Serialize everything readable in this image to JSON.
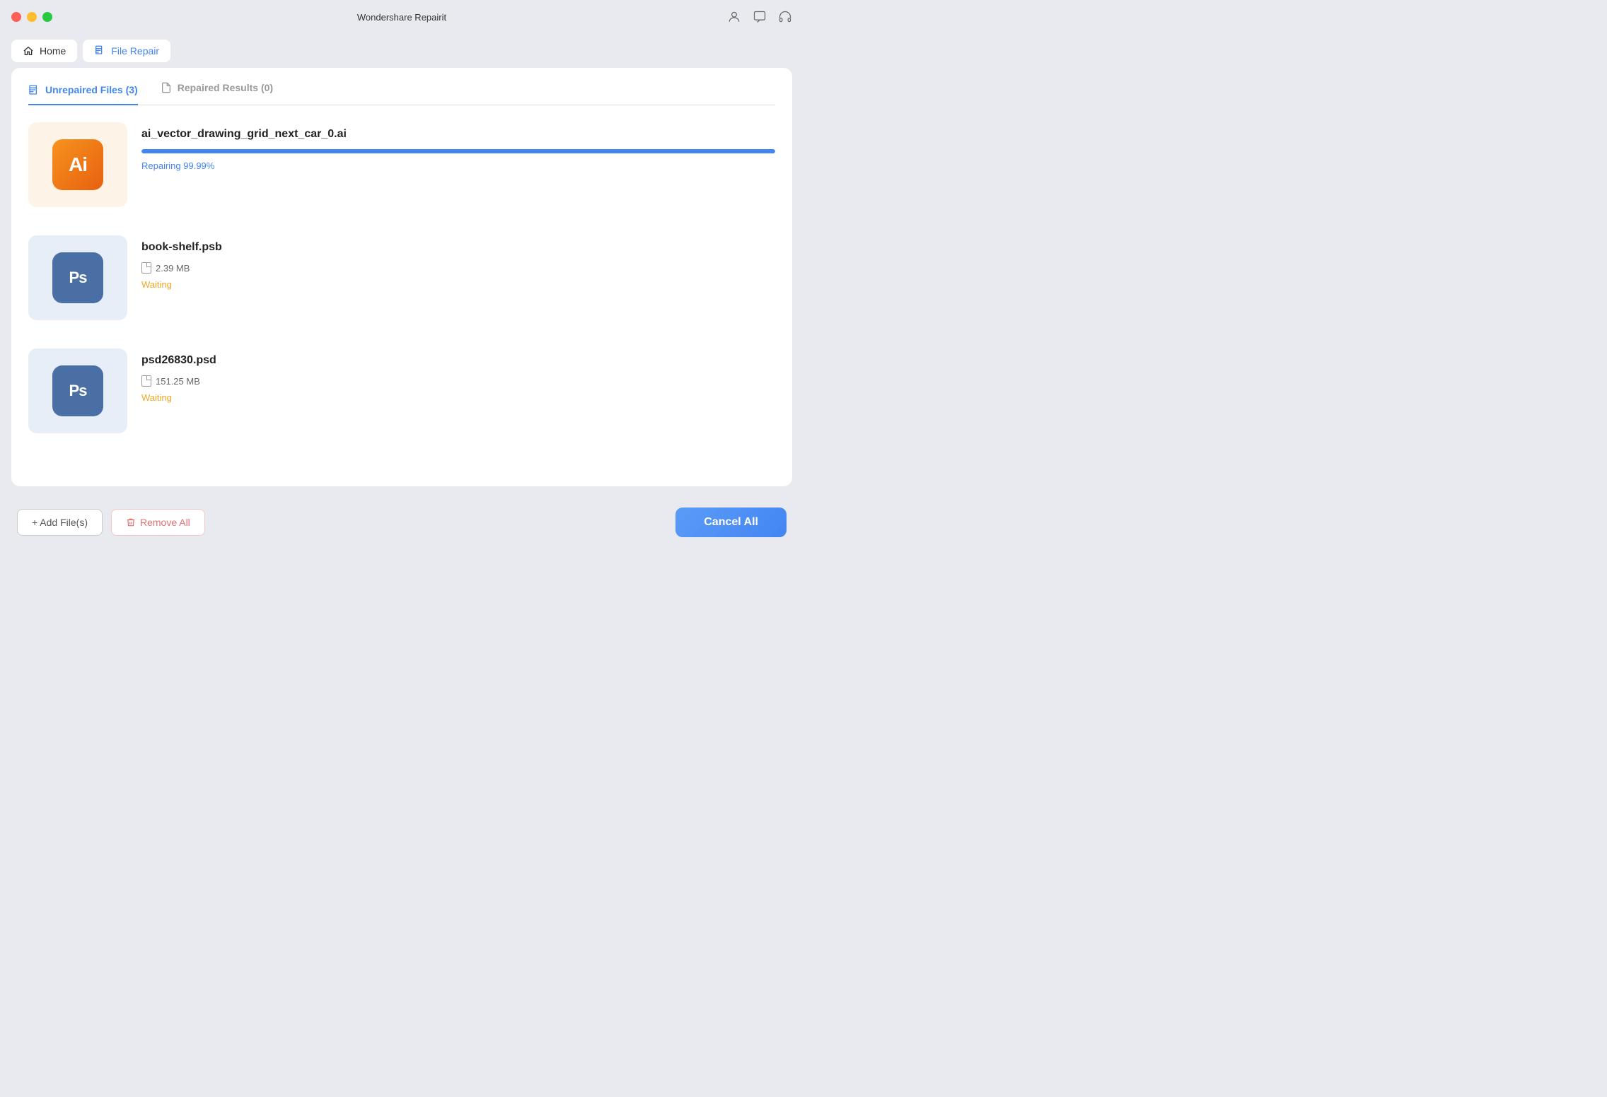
{
  "app": {
    "title": "Wondershare Repairit"
  },
  "titlebar": {
    "traffic": {
      "close": "close",
      "minimize": "minimize",
      "maximize": "maximize"
    },
    "icons": [
      "user-icon",
      "chat-icon",
      "headphone-icon"
    ]
  },
  "nav": {
    "home_label": "Home",
    "file_repair_label": "File Repair"
  },
  "subtabs": {
    "unrepaired_label": "Unrepaired Files (3)",
    "repaired_label": "Repaired Results (0)"
  },
  "files": [
    {
      "name": "ai_vector_drawing_grid_next_car_0.ai",
      "type": "ai",
      "icon_text": "Ai",
      "progress": 99.99,
      "status": "Repairing 99.99%",
      "status_type": "repairing"
    },
    {
      "name": "book-shelf.psb",
      "type": "ps",
      "icon_text": "Ps",
      "size": "2.39 MB",
      "status": "Waiting",
      "status_type": "waiting"
    },
    {
      "name": "psd26830.psd",
      "type": "ps",
      "icon_text": "Ps",
      "size": "151.25 MB",
      "status": "Waiting",
      "status_type": "waiting"
    }
  ],
  "buttons": {
    "add_files": "+ Add File(s)",
    "remove_all": "Remove All",
    "cancel_all": "Cancel All"
  }
}
